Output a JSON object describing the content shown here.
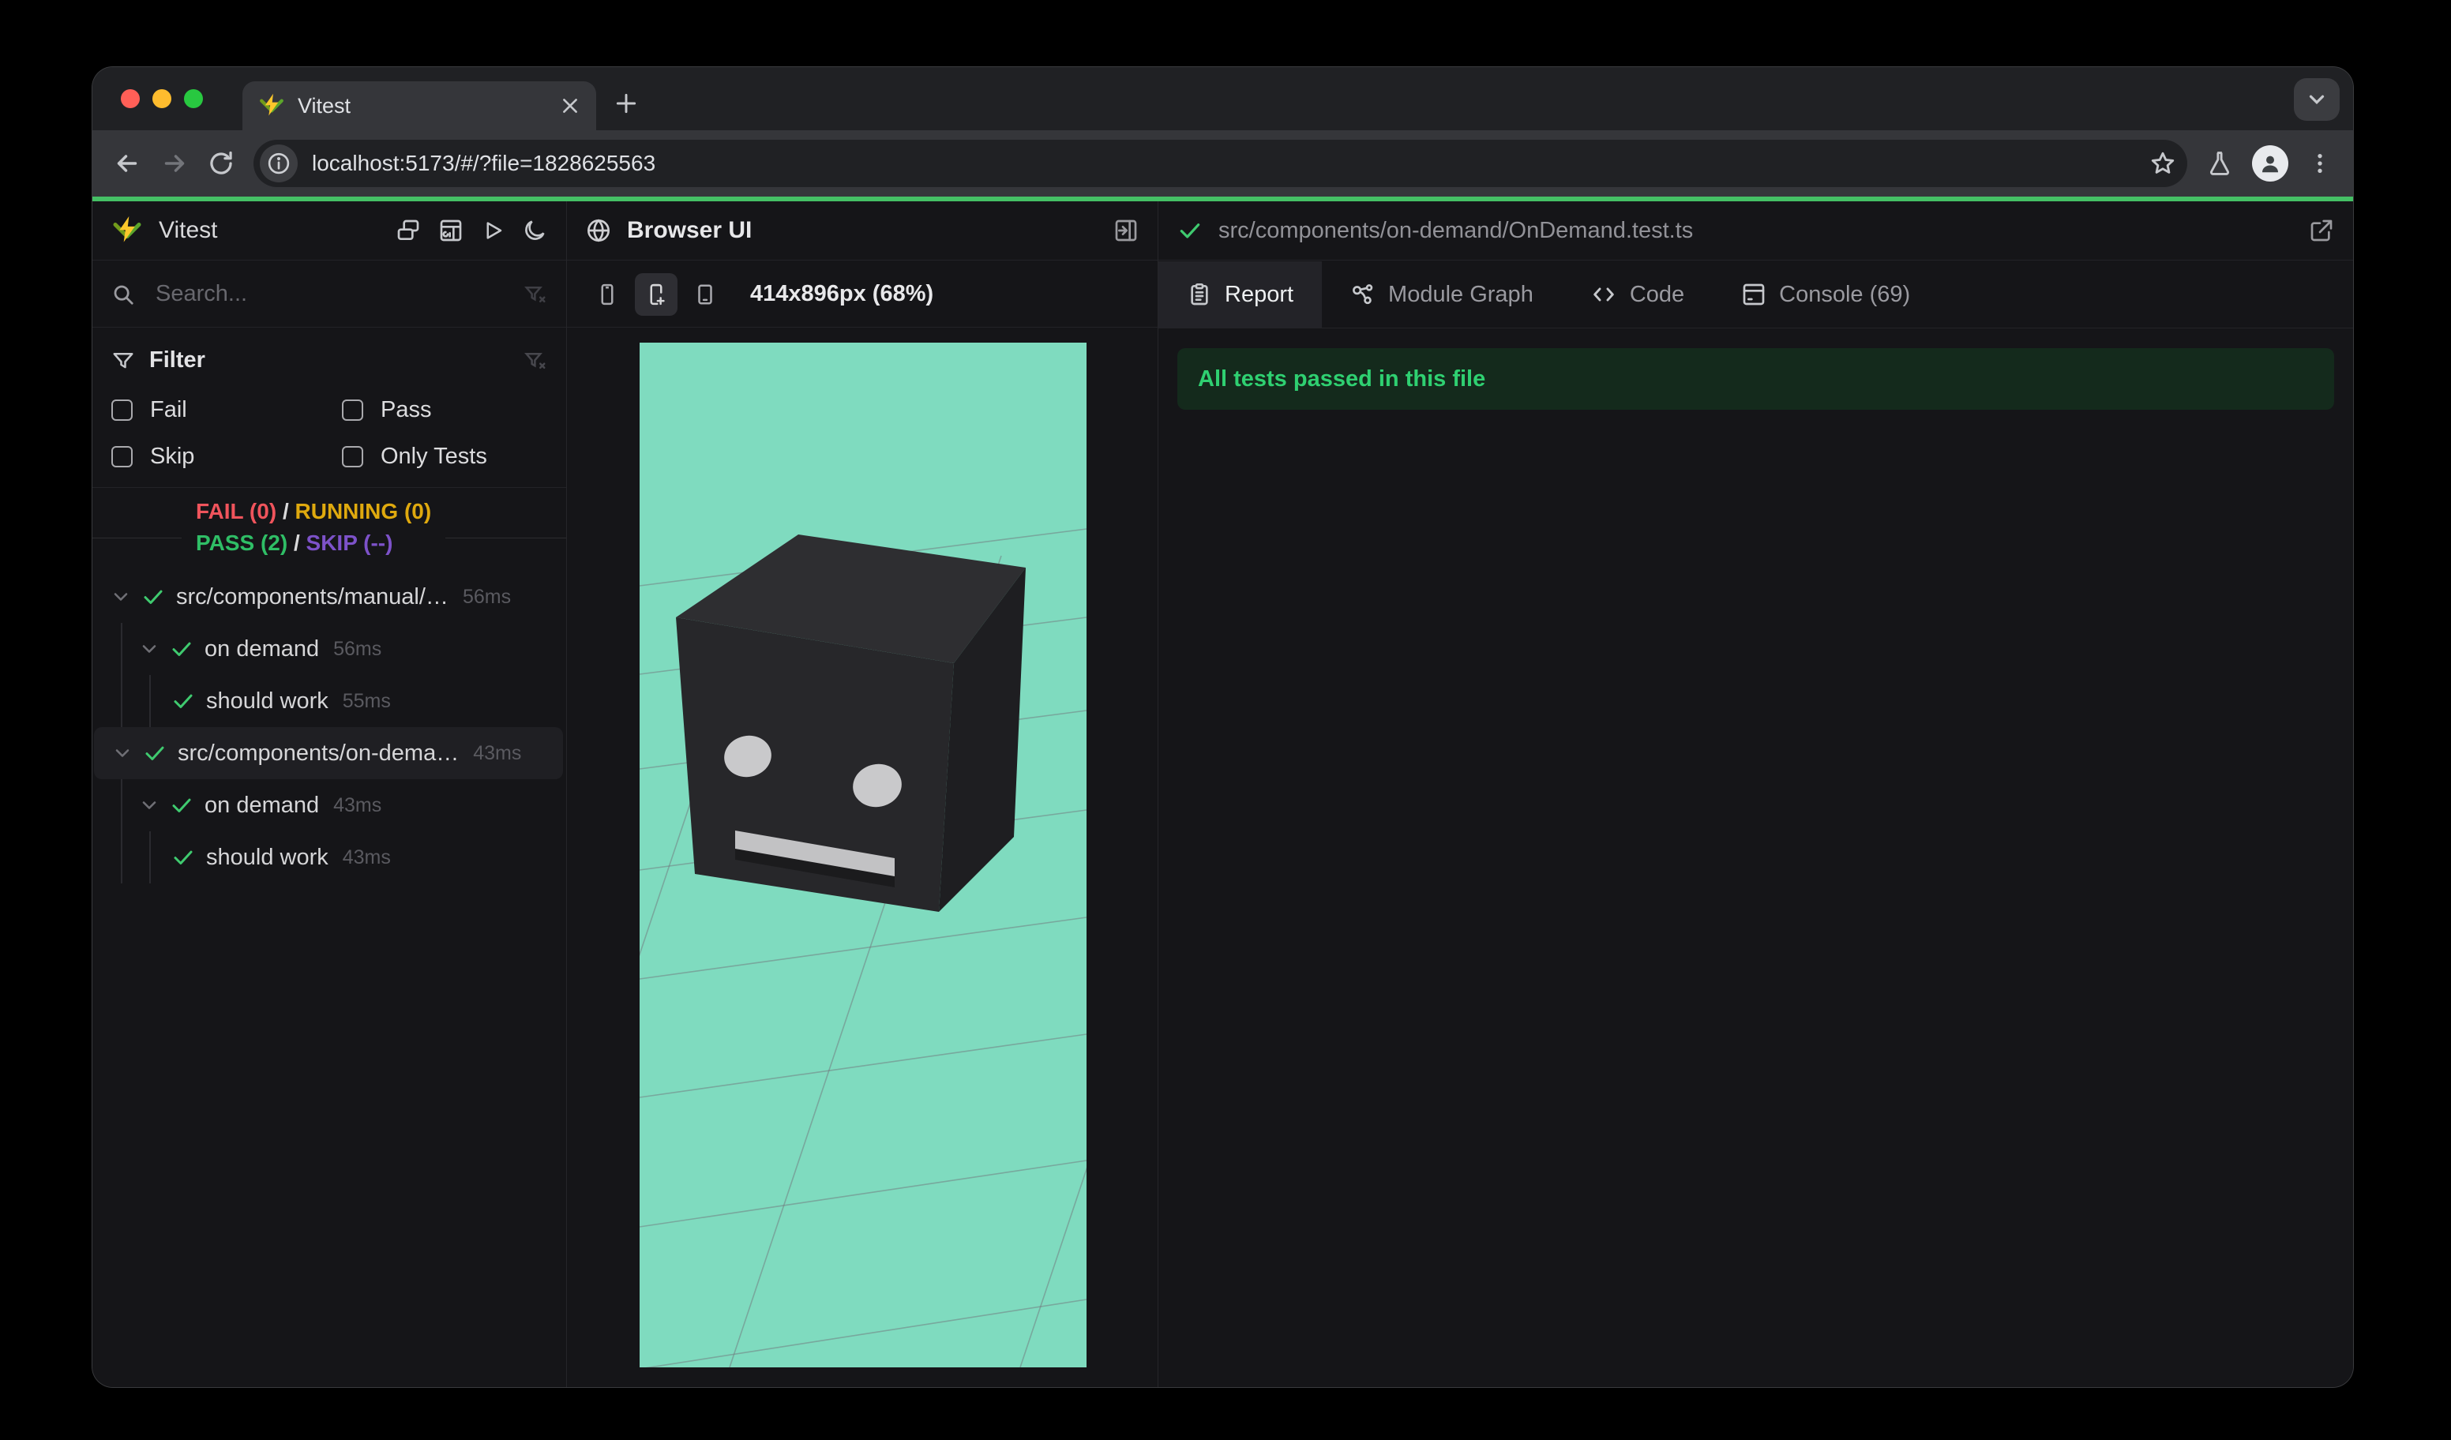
{
  "browser": {
    "tab_title": "Vitest",
    "url": "localhost:5173/#/?file=1828625563"
  },
  "sidebar": {
    "brand": "Vitest",
    "search_placeholder": "Search...",
    "filter": {
      "title": "Filter",
      "options": [
        "Fail",
        "Pass",
        "Skip",
        "Only Tests"
      ]
    },
    "stats": {
      "fail": "FAIL (0)",
      "running": "RUNNING (0)",
      "pass": "PASS (2)",
      "skip": "SKIP (--)",
      "separator": "/"
    },
    "tree": [
      {
        "depth": 0,
        "label": "src/components/manual/…",
        "time": "56ms",
        "chevron": true,
        "selected": false
      },
      {
        "depth": 1,
        "label": "on demand",
        "time": "56ms",
        "chevron": true,
        "selected": false
      },
      {
        "depth": 2,
        "label": "should work",
        "time": "55ms",
        "chevron": false,
        "selected": false
      },
      {
        "depth": 0,
        "label": "src/components/on-dema…",
        "time": "43ms",
        "chevron": true,
        "selected": true
      },
      {
        "depth": 1,
        "label": "on demand",
        "time": "43ms",
        "chevron": true,
        "selected": false
      },
      {
        "depth": 2,
        "label": "should work",
        "time": "43ms",
        "chevron": false,
        "selected": false
      }
    ]
  },
  "browser_panel": {
    "title": "Browser UI",
    "viewport_label": "414x896px (68%)"
  },
  "report_panel": {
    "file_path": "src/components/on-demand/OnDemand.test.ts",
    "tabs": [
      {
        "label": "Report",
        "icon": "report",
        "active": true
      },
      {
        "label": "Module Graph",
        "icon": "graph",
        "active": false
      },
      {
        "label": "Code",
        "icon": "code",
        "active": false
      },
      {
        "label": "Console (69)",
        "icon": "console",
        "active": false
      }
    ],
    "banner": "All tests passed in this file"
  },
  "colors": {
    "accent_green": "#45c065",
    "pass_green": "#2fbe66",
    "fail_red": "#f0545c",
    "running_yellow": "#dfa90e",
    "skip_purple": "#7d52c9",
    "banner_bg": "#142a1c",
    "banner_text": "#2fd071",
    "preview_background": "#7fdbbf",
    "logo_yellow": "#fcc72b",
    "logo_green": "#729b1b"
  }
}
